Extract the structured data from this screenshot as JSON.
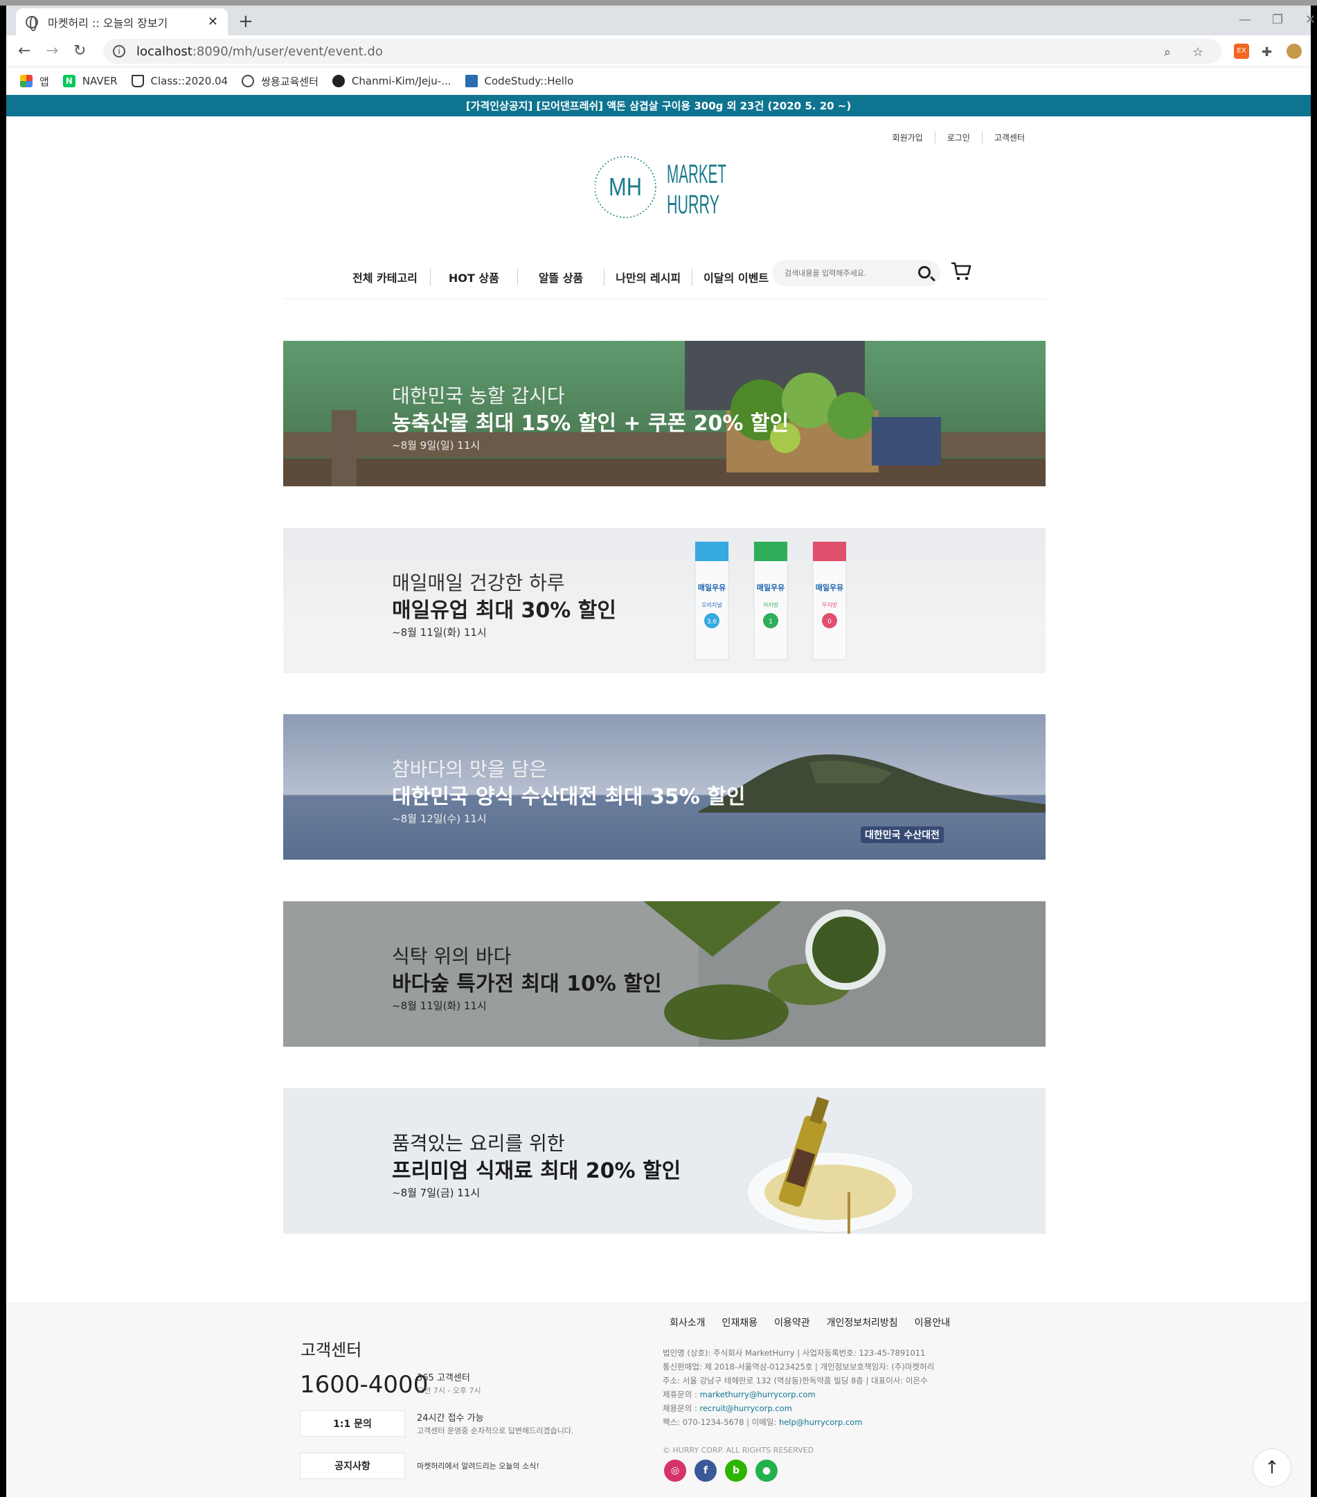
{
  "browser": {
    "tab_title": "마켓허리 :: 오늘의 장보기",
    "new_tab": "+",
    "url_host": "localhost",
    "url_rest": ":8090/mh/user/event/event.do",
    "bookmarks": [
      {
        "label": "앱",
        "icon": "apps-grid-icon"
      },
      {
        "label": "NAVER",
        "icon": "naver-icon"
      },
      {
        "label": "Class::2020.04",
        "icon": "coffee-icon"
      },
      {
        "label": "쌍용교육센터",
        "icon": "globe-icon"
      },
      {
        "label": "Chanmi-Kim/Jeju-...",
        "icon": "github-icon"
      },
      {
        "label": "CodeStudy::Hello",
        "icon": "monitor-icon"
      }
    ]
  },
  "site": {
    "notice": "[가격인상공지] [모어댄프레쉬] 액돈 삼겹살 구이용 300g 외 23건 (2020 5. 20 ~)",
    "toplinks": [
      "회원가입",
      "로그인",
      "고객센터"
    ],
    "logo": {
      "mono": "MH",
      "line1": "MARKET",
      "line2": "HURRY",
      "color": "#1a7a8c"
    },
    "nav": [
      "전체 카테고리",
      "HOT 상품",
      "알뜰 상품",
      "나만의 레시피",
      "이달의 이벤트"
    ],
    "search_placeholder": "검색내용을 입력해주세요.",
    "accent": "#0e7490"
  },
  "banners": [
    {
      "sub": "대한민국 농할 갑시다",
      "main": "농축산물 최대 15% 할인 + 쿠폰 20% 할인",
      "period": "~8월 9일(일) 11시",
      "theme": "farm"
    },
    {
      "sub": "매일매일 건강한 하루",
      "main": "매일유업 최대 30% 할인",
      "period": "~8월 11일(화) 11시",
      "theme": "milk",
      "cartons": [
        {
          "label": "매일우유",
          "tag": "오리지널",
          "num": "3.6"
        },
        {
          "label": "매일우유",
          "tag": "저지방",
          "num": "1"
        },
        {
          "label": "매일우유",
          "tag": "무지방",
          "num": "0"
        }
      ]
    },
    {
      "sub": "참바다의 맛을 담은",
      "main": "대한민국 양식 수산대전 최대 35% 할인",
      "period": "~8월 12일(수) 11시",
      "theme": "sea",
      "badge": "대한민국 수산대전"
    },
    {
      "sub": "식탁 위의 바다",
      "main": "바다숲 특가전 최대 10% 할인",
      "period": "~8월 11일(화) 11시",
      "theme": "seaweed"
    },
    {
      "sub": "품격있는 요리를 위한",
      "main": "프리미엄 식재료 최대 20% 할인",
      "period": "~8월 7일(금) 11시",
      "theme": "oil"
    }
  ],
  "footer": {
    "cs_title": "고객센터",
    "phone": "1600-4000",
    "cs_365": "365 고객센터",
    "cs_hours": "오전 7시 - 오후 7시",
    "btn_inquiry": "1:1 문의",
    "inquiry_desc": "24시간 접수 가능",
    "inquiry_desc2": "고객센터 운영중 순차적으로 답변해드리겠습니다.",
    "btn_notice": "공지사항",
    "notice_desc": "마켓허리에서 알려드리는 오늘의 소식!",
    "links": [
      "회사소개",
      "인재채용",
      "이용약관",
      "개인정보처리방침",
      "이용안내"
    ],
    "info_lines": [
      "법인명 (상호): 주식회사 MarketHurry  |  사업자등록번호: 123-45-7891011",
      "통신판매업: 제 2018-서울역삼-0123425호  |  개인정보보호책임자: (주)마켓허리",
      "주소: 서울 강남구 테헤란로 132 (역삼동)한독약품 빌딩 8층  |  대표이사: 이은수"
    ],
    "partner_label": "제휴문의 : ",
    "partner_email": "markethurry@hurrycorp.com",
    "recruit_label": "채용문의 : ",
    "recruit_email": "recruit@hurrycorp.com",
    "fax_label": "팩스: 070-1234-5678  |  이메일: ",
    "help_email": "help@hurrycorp.com",
    "copyright": "© HURRY CORP. ALL RIGHTS RESERVED",
    "social": [
      {
        "name": "instagram-icon",
        "color": "#d6336c"
      },
      {
        "name": "facebook-icon",
        "color": "#3b5998"
      },
      {
        "name": "blog-icon",
        "color": "#2db400"
      },
      {
        "name": "kakao-icon",
        "color": "#22b14c"
      }
    ],
    "to_top": "↑"
  }
}
